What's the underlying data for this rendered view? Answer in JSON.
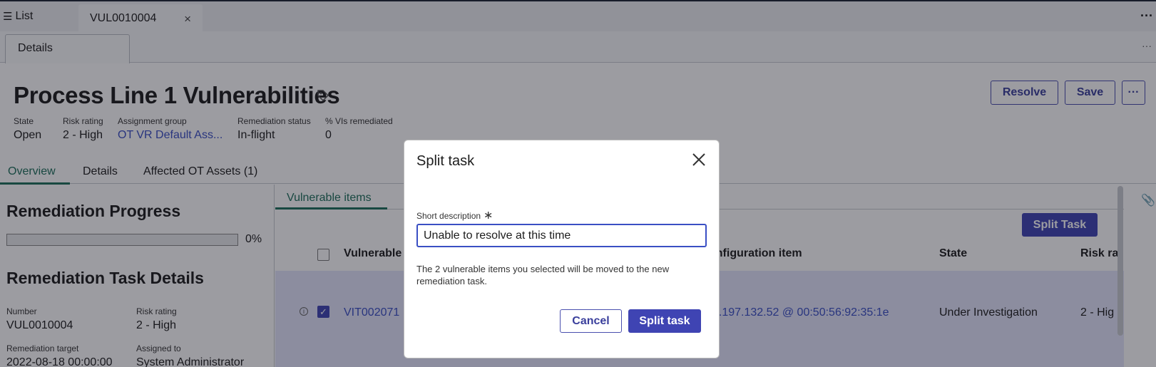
{
  "topbar": {
    "list_label": "List",
    "record_tab": "VUL0010004",
    "close_glyph": "×",
    "more_glyph": "···"
  },
  "secbar": {
    "details_tab": "Details",
    "more_glyph": "···"
  },
  "header": {
    "title": "Process Line 1 Vulnerabilities",
    "buttons": {
      "resolve": "Resolve",
      "save": "Save",
      "more": "···"
    },
    "fields": [
      {
        "label": "State",
        "value": "Open"
      },
      {
        "label": "Risk rating",
        "value": "2 - High"
      },
      {
        "label": "Assignment group",
        "value": "OT VR Default Ass..."
      },
      {
        "label": "Remediation status",
        "value": "In-flight"
      },
      {
        "label": "% VIs remediated",
        "value": "0"
      }
    ]
  },
  "overview_tabs": [
    "Overview",
    "Details",
    "Affected OT Assets (1)"
  ],
  "left_panel": {
    "progress_title": "Remediation Progress",
    "progress_percent": 0,
    "progress_label": "0%",
    "details_title": "Remediation Task Details",
    "fields": [
      {
        "label": "Number",
        "value": "VUL0010004"
      },
      {
        "label": "Risk rating",
        "value": "2 - High"
      },
      {
        "label": "Remediation target",
        "value": "2022-08-18 00:00:00"
      },
      {
        "label": "Assigned to",
        "value": "System Administrator"
      }
    ]
  },
  "right_panel": {
    "tab": "Vulnerable items",
    "split_task_button": "Split Task",
    "columns": [
      "Vulnerable",
      "onfiguration item",
      "State",
      "Risk ra"
    ],
    "row": {
      "id": "VIT002071",
      "config_item": "0.197.132.52 @ 00:50:56:92:35:1e",
      "state": "Under Investigation",
      "risk": "2 - Hig"
    }
  },
  "modal": {
    "title": "Split task",
    "label": "Short description",
    "required_mark": "∗",
    "input_value": "Unable to resolve at this time",
    "message": "The 2 vulnerable items you selected will be moved to the new remediation task.",
    "cancel": "Cancel",
    "submit": "Split task"
  }
}
